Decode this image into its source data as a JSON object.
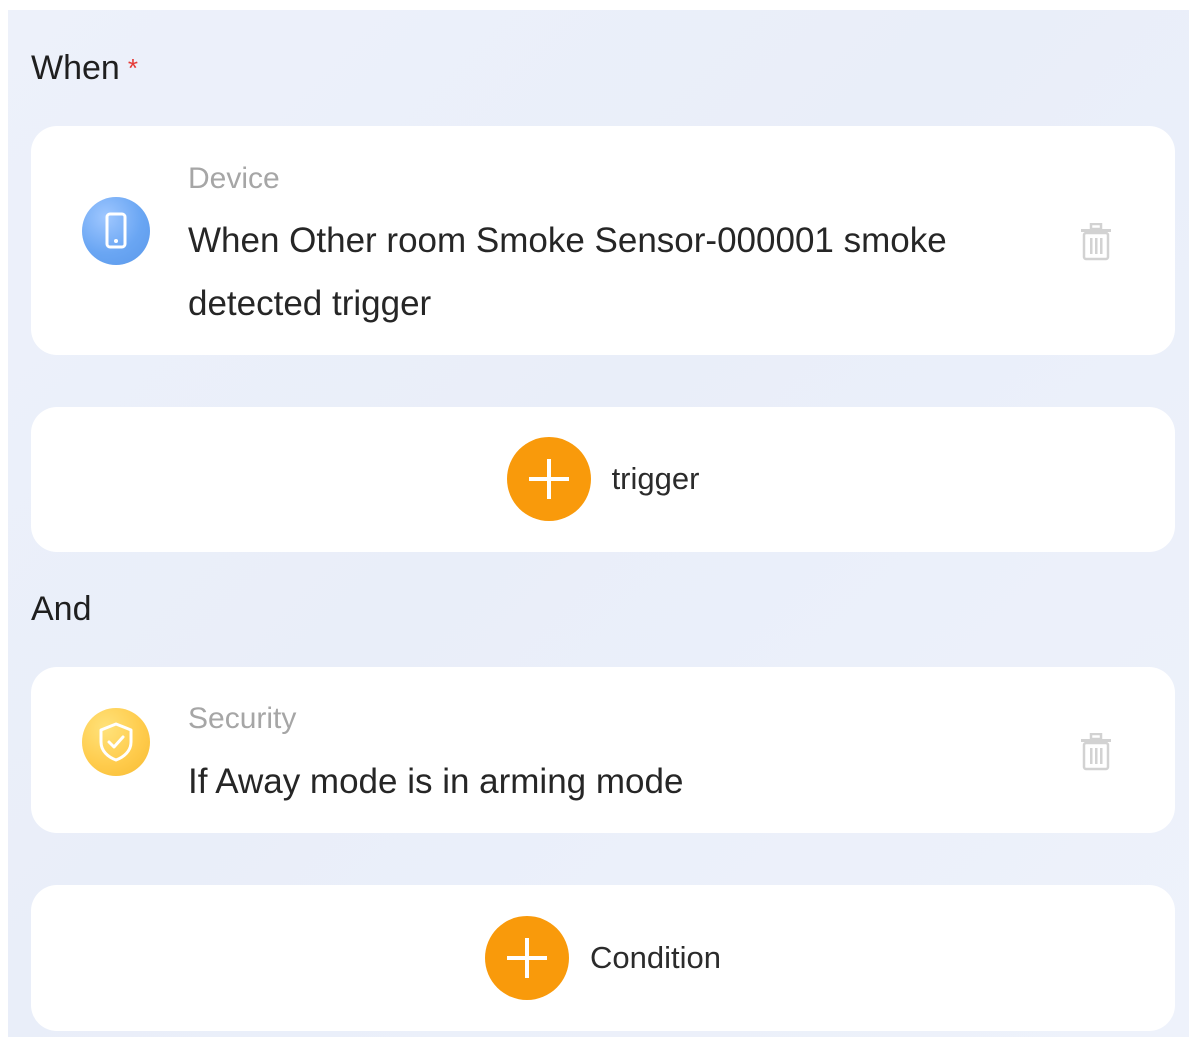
{
  "when_section": {
    "title": "When",
    "required_mark": "*"
  },
  "trigger_item": {
    "category": "Device",
    "description": "When Other room Smoke Sensor-000001 smoke detected trigger",
    "icon": "phone-device-icon",
    "icon_color": "#6aa6f3"
  },
  "add_trigger": {
    "label": "trigger",
    "icon": "plus-icon",
    "color": "#f99a0b"
  },
  "and_section": {
    "title": "And"
  },
  "condition_item": {
    "category": "Security",
    "description": "If Away mode is in arming mode",
    "icon": "shield-check-icon",
    "icon_color": "#ffcc4d"
  },
  "add_condition": {
    "label": "Condition",
    "icon": "plus-icon",
    "color": "#f99a0b"
  }
}
